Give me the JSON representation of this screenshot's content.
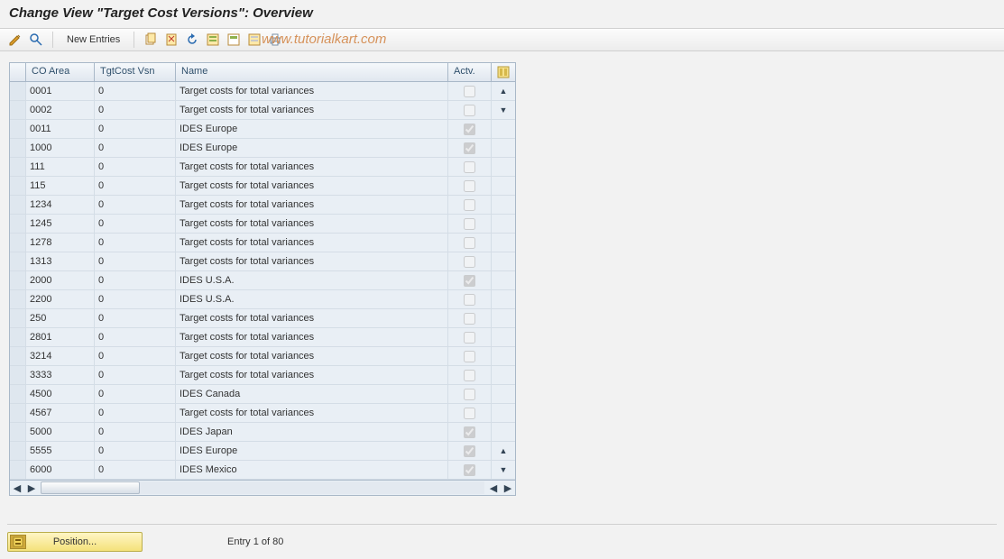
{
  "title": "Change View \"Target Cost Versions\": Overview",
  "watermark": "www.tutorialkart.com",
  "toolbar": {
    "new_entries_label": "New Entries"
  },
  "columns": {
    "co_area": "CO Area",
    "tgtcost_vsn": "TgtCost Vsn",
    "name": "Name",
    "actv": "Actv."
  },
  "rows": [
    {
      "co": "0001",
      "ver": "0",
      "name": "Target costs for total variances",
      "actv": false,
      "highlight": true
    },
    {
      "co": "0002",
      "ver": "0",
      "name": "Target costs for total variances",
      "actv": false
    },
    {
      "co": "0011",
      "ver": "0",
      "name": "IDES Europe",
      "actv": true
    },
    {
      "co": "1000",
      "ver": "0",
      "name": "IDES Europe",
      "actv": true
    },
    {
      "co": "111",
      "ver": "0",
      "name": "Target costs for total variances",
      "actv": false
    },
    {
      "co": "115",
      "ver": "0",
      "name": "Target costs for total variances",
      "actv": false
    },
    {
      "co": "1234",
      "ver": "0",
      "name": "Target costs for total variances",
      "actv": false
    },
    {
      "co": "1245",
      "ver": "0",
      "name": "Target costs for total variances",
      "actv": false
    },
    {
      "co": "1278",
      "ver": "0",
      "name": "Target costs for total variances",
      "actv": false
    },
    {
      "co": "1313",
      "ver": "0",
      "name": "Target costs for total variances",
      "actv": false
    },
    {
      "co": "2000",
      "ver": "0",
      "name": "IDES U.S.A.",
      "actv": true
    },
    {
      "co": "2200",
      "ver": "0",
      "name": "IDES U.S.A.",
      "actv": false
    },
    {
      "co": "250",
      "ver": "0",
      "name": "Target costs for total variances",
      "actv": false
    },
    {
      "co": "2801",
      "ver": "0",
      "name": "Target costs for total variances",
      "actv": false
    },
    {
      "co": "3214",
      "ver": "0",
      "name": "Target costs for total variances",
      "actv": false
    },
    {
      "co": "3333",
      "ver": "0",
      "name": "Target costs for total variances",
      "actv": false
    },
    {
      "co": "4500",
      "ver": "0",
      "name": "IDES Canada",
      "actv": false
    },
    {
      "co": "4567",
      "ver": "0",
      "name": "Target costs for total variances",
      "actv": false
    },
    {
      "co": "5000",
      "ver": "0",
      "name": "IDES Japan",
      "actv": true
    },
    {
      "co": "5555",
      "ver": "0",
      "name": "IDES Europe",
      "actv": true
    },
    {
      "co": "6000",
      "ver": "0",
      "name": "IDES Mexico",
      "actv": true
    }
  ],
  "footer": {
    "position_label": "Position...",
    "entry_info": "Entry 1 of 80"
  }
}
